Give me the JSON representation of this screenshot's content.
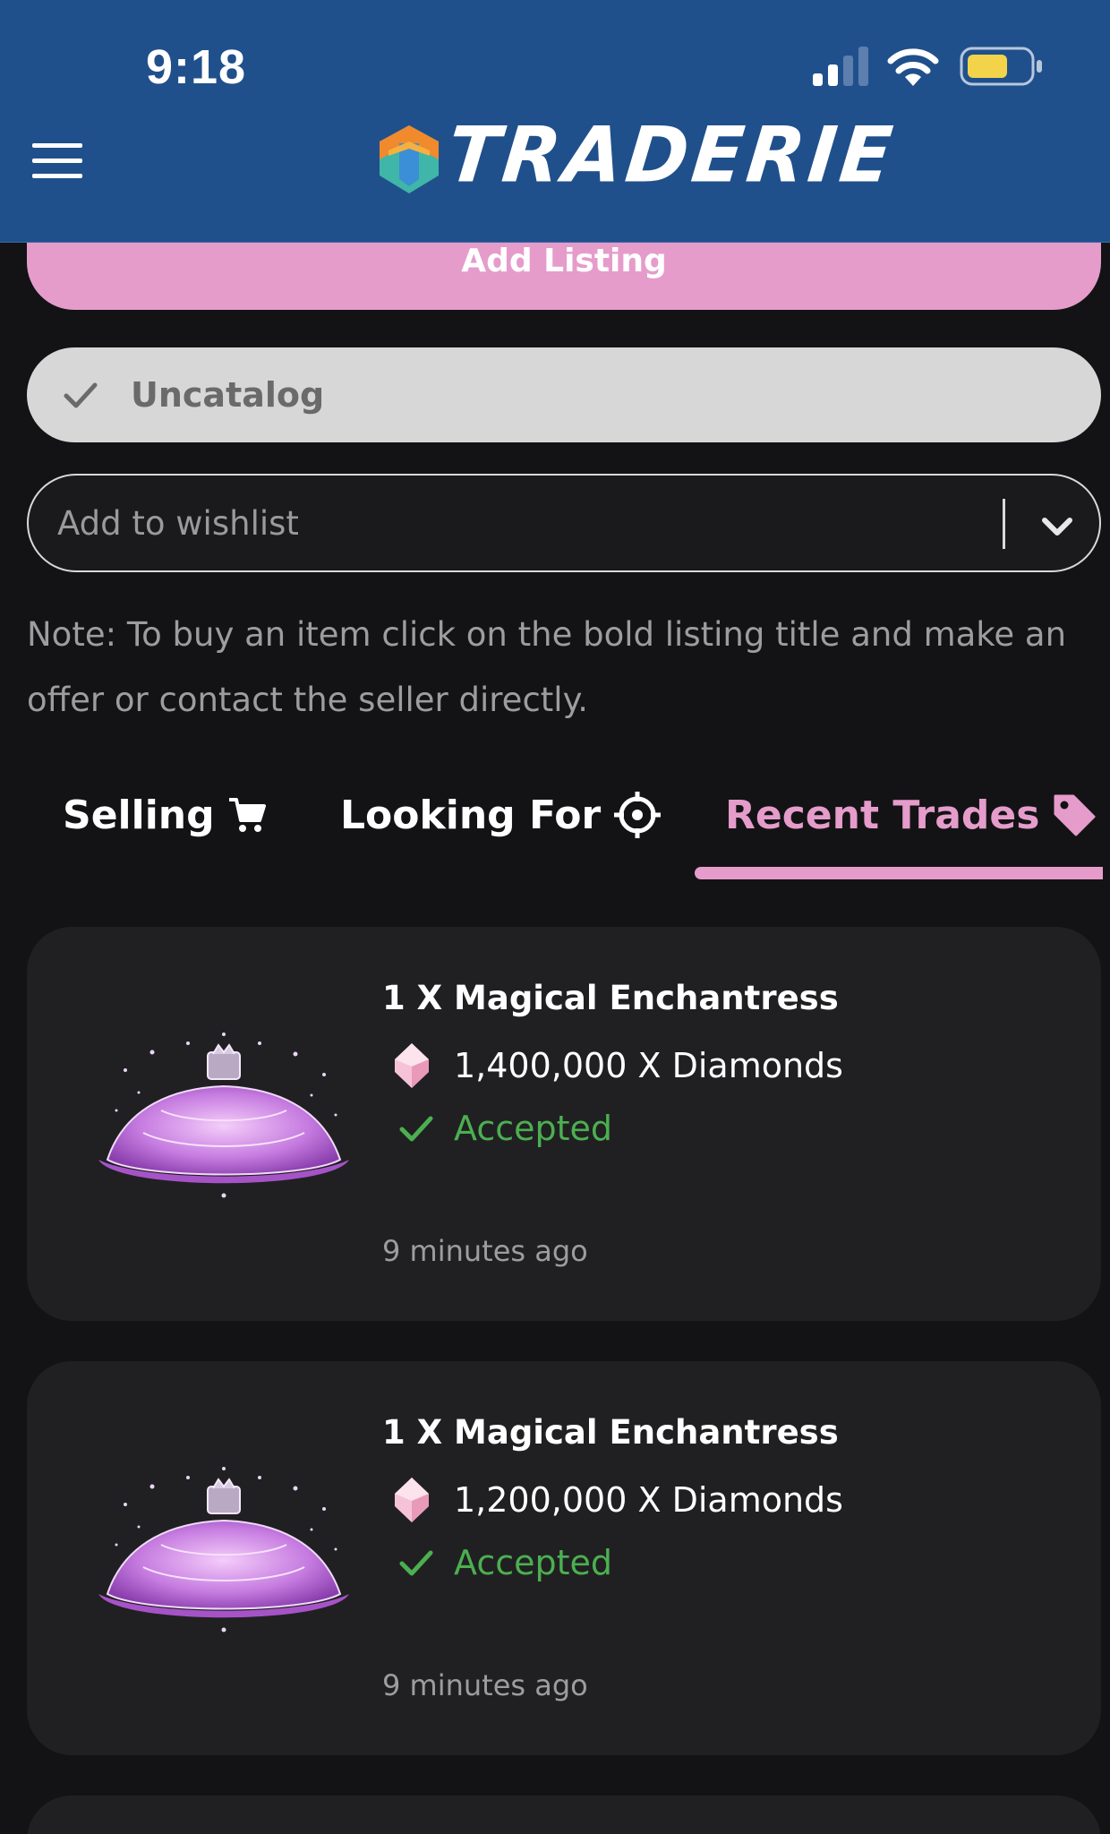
{
  "status_bar": {
    "time": "9:18",
    "icons": [
      "signal-icon",
      "wifi-icon",
      "battery-icon"
    ]
  },
  "header": {
    "logo_text": "TRADERIE",
    "menu_icon": "hamburger-menu-icon",
    "background_color": "#20508c"
  },
  "actions": {
    "add_listing_label": "Add Listing",
    "uncatalog_label": "Uncatalog",
    "wishlist_placeholder": "Add to wishlist",
    "accent_color": "#e59ccb"
  },
  "note": "Note: To buy an item click on the bold listing title and make an offer or contact the seller directly.",
  "tabs": [
    {
      "label": "Selling",
      "icon": "cart-icon",
      "active": false
    },
    {
      "label": "Looking For",
      "icon": "crosshair-icon",
      "active": false
    },
    {
      "label": "Recent Trades",
      "icon": "tag-icon",
      "active": true
    }
  ],
  "trades": [
    {
      "title": "1 X Magical Enchantress",
      "price": "1,400,000 X Diamonds",
      "price_icon": "diamond-icon",
      "status": "Accepted",
      "status_color": "#4caf50",
      "time": "9 minutes ago"
    },
    {
      "title": "1 X Magical Enchantress",
      "price": "1,200,000 X Diamonds",
      "price_icon": "diamond-icon",
      "status": "Accepted",
      "status_color": "#4caf50",
      "time": "9 minutes ago"
    }
  ]
}
